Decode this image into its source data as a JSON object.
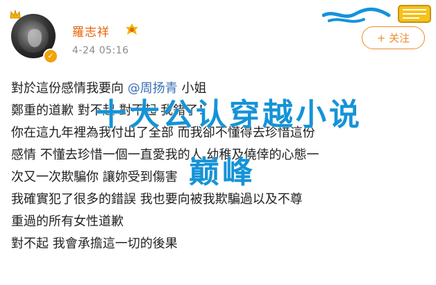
{
  "post": {
    "username": "羅志祥",
    "timestamp": "4-24 05:16",
    "follow_label": "+ 关注",
    "lines": [
      {
        "before": "對於這份感情我要向 ",
        "mention": "@周扬青",
        "after": " 小姐"
      },
      {
        "before": "鄭重的道歉 對不起 對不起 我錯了！",
        "mention": "",
        "after": ""
      },
      {
        "before": "你在這九年裡為我付出了全部 而我卻不懂得去珍惜這份",
        "mention": "",
        "after": ""
      },
      {
        "before": "感情 不懂去珍惜一個一直愛我的人 幼稚及僥倖的心態一",
        "mention": "",
        "after": ""
      },
      {
        "before": "次又一次欺騙你 讓妳受到傷害",
        "mention": "",
        "after": ""
      },
      {
        "before": "我確實犯了很多的錯誤 我也要向被我欺騙過以及不尊",
        "mention": "",
        "after": ""
      },
      {
        "before": "重過的所有女性道歉",
        "mention": "",
        "after": ""
      },
      {
        "before": "對不起   我會承擔這一切的後果",
        "mention": "",
        "after": ""
      }
    ]
  },
  "watermark": {
    "line1": "十大公认穿越小说",
    "line2": "巅峰"
  },
  "colors": {
    "username": "#e8630a",
    "mention": "#3a6fb5",
    "follow": "#f08a2a",
    "watermark": "#1593d8"
  },
  "icons": [
    "crown-icon",
    "verified-icon",
    "badge-icon",
    "decoration-logo"
  ]
}
